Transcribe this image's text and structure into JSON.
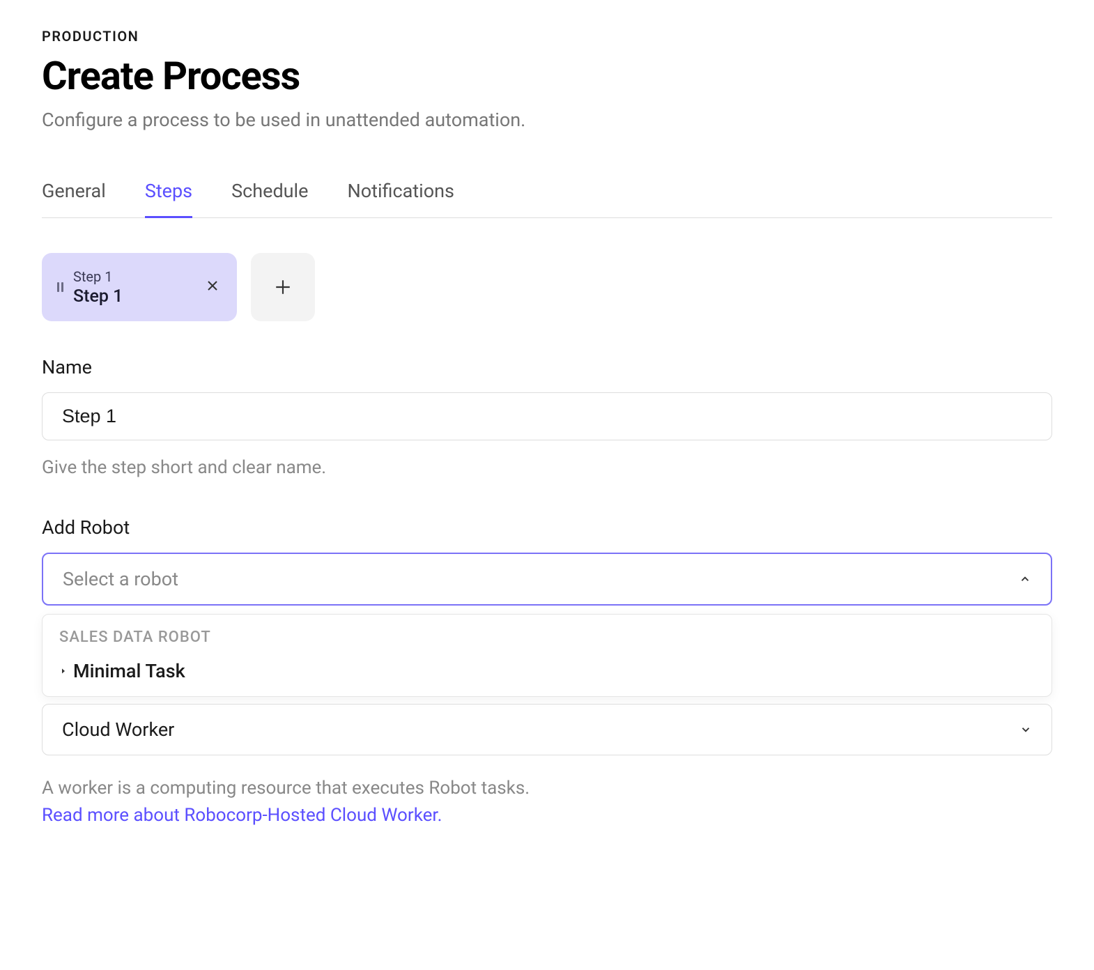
{
  "breadcrumb": "PRODUCTION",
  "title": "Create Process",
  "subtitle": "Configure a process to be used in unattended automation.",
  "tabs": [
    {
      "label": "General",
      "active": false
    },
    {
      "label": "Steps",
      "active": true
    },
    {
      "label": "Schedule",
      "active": false
    },
    {
      "label": "Notifications",
      "active": false
    }
  ],
  "step_pill": {
    "label": "Step 1",
    "title": "Step 1"
  },
  "name_field": {
    "label": "Name",
    "value": "Step 1",
    "helper": "Give the step short and clear name."
  },
  "robot_field": {
    "label": "Add Robot",
    "placeholder": "Select a robot",
    "group_label": "SALES DATA ROBOT",
    "option": "Minimal Task"
  },
  "worker_field": {
    "value": "Cloud Worker",
    "description": "A worker is a computing resource that executes Robot tasks.",
    "link": "Read more about Robocorp-Hosted Cloud Worker."
  }
}
